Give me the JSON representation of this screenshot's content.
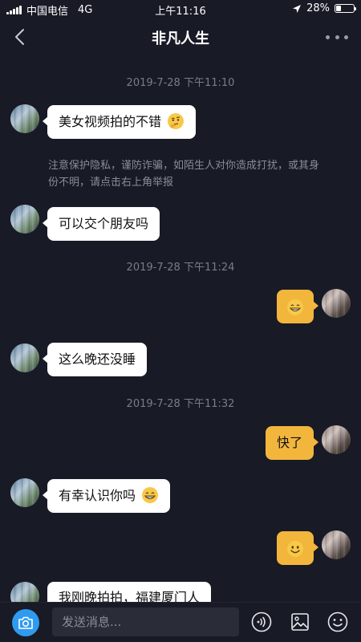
{
  "status_bar": {
    "carrier": "中国电信",
    "network": "4G",
    "time": "上午11:16",
    "battery_percent": "28%",
    "battery_level": 0.28
  },
  "header": {
    "title": "非凡人生",
    "back_icon": "chevron-left-icon",
    "more_icon": "more-horizontal-icon"
  },
  "messages": {
    "ts1": "2019-7-28 下午11:10",
    "m1": "美女视频拍的不错",
    "notice": "注意保护隐私，谨防诈骗，如陌生人对你造成打扰，或其身份不明，请点击右上角举报",
    "m2": "可以交个朋友吗",
    "ts2": "2019-7-28 下午11:24",
    "ts3": "2019-7-28 下午11:32",
    "m4": "这么晚还没睡",
    "m5": "快了",
    "m6": "有幸认识你吗",
    "m8": "我刚晚拍拍，福建厦门人"
  },
  "composer": {
    "placeholder": "发送消息...",
    "camera_icon": "camera-icon",
    "voice_icon": "voice-icon",
    "image_icon": "image-icon",
    "emoji_icon": "emoji-icon"
  },
  "colors": {
    "background": "#181a26",
    "incoming_bubble": "#ffffff",
    "outgoing_bubble": "#f2b63d",
    "accent": "#2f9bf0"
  }
}
